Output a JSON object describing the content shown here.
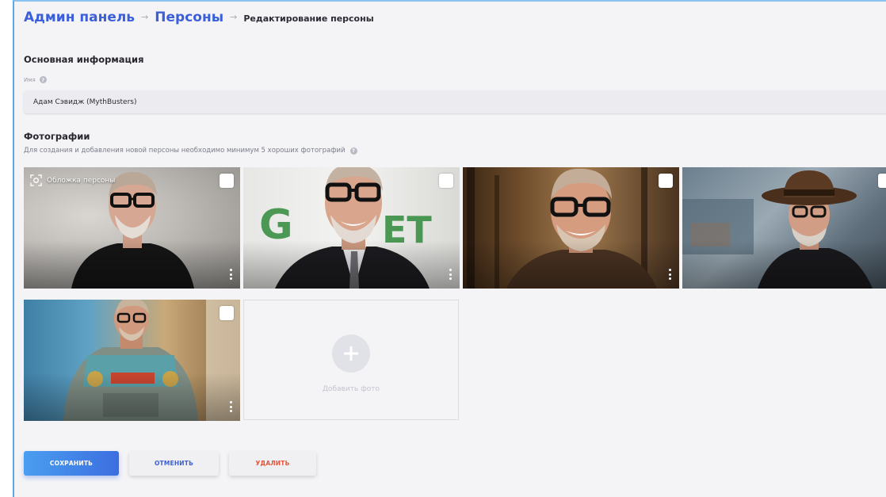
{
  "breadcrumb": {
    "admin": "Админ панель",
    "persons": "Персоны",
    "current": "Редактирование персоны",
    "separator": "→"
  },
  "basic_info": {
    "title": "Основная информация",
    "name_label": "Имя",
    "name_value": "Адам Сэвидж (MythBusters)"
  },
  "photos": {
    "title": "Фотографии",
    "hint": "Для создания и добавления новой персоны необходимо минимум 5 хороших фотографий",
    "cover_label": "Обложка персоны",
    "add_label": "Добавить фото",
    "items": [
      {
        "description": "man with glasses, black t-shirt, white ornate background",
        "is_cover": true
      },
      {
        "description": "man with glasses, suit and tie, green logo background",
        "is_cover": false
      },
      {
        "description": "man with glasses smiling, shop interior background",
        "is_cover": false
      },
      {
        "description": "man with brown fedora hat and glasses",
        "is_cover": false
      },
      {
        "description": "man in space suit costume",
        "is_cover": false
      }
    ]
  },
  "actions": {
    "save": "СОХРАНИТЬ",
    "cancel": "ОТМЕНИТЬ",
    "delete": "УДАЛИТЬ"
  },
  "colors": {
    "accent": "#3b5fd9",
    "danger": "#e2553a",
    "background": "#f4f4f7"
  }
}
